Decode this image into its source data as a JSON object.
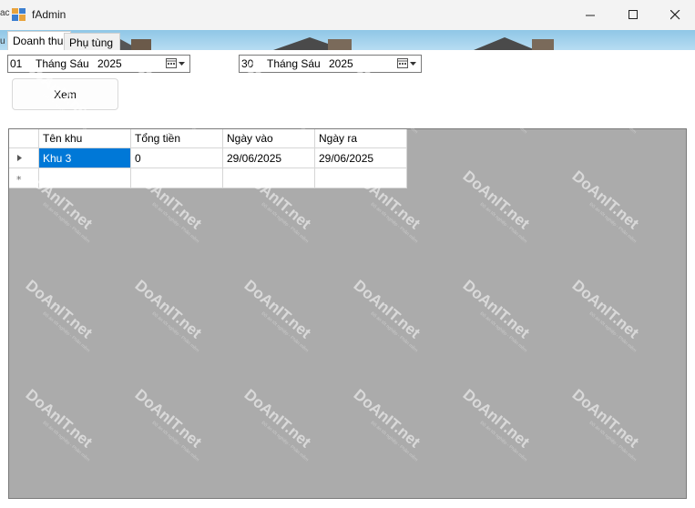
{
  "window": {
    "title": "fAdmin",
    "left_edge_text": "ac",
    "left_edge_text2": "u"
  },
  "tabs": [
    {
      "label": "Doanh thu",
      "active": true
    },
    {
      "label": "Phụ tùng",
      "active": false
    }
  ],
  "filters": {
    "from_date": {
      "day": "01",
      "month": "Tháng Sáu",
      "year": "2025"
    },
    "to_date": {
      "day": "30",
      "month": "Tháng Sáu",
      "year": "2025"
    },
    "view_button": "Xem"
  },
  "grid": {
    "columns": [
      "Tên khu",
      "Tổng tiền",
      "Ngày vào",
      "Ngày ra"
    ],
    "rows": [
      [
        "Khu 3",
        "0",
        "29/06/2025",
        "29/06/2025"
      ]
    ]
  },
  "watermark": {
    "text": "DoAnIT.net",
    "subtext": "Đồ án tốt nghiệp - Phần mềm"
  },
  "colors": {
    "selection": "#0078d7",
    "grid_background": "#ababab",
    "banner": "#9fd0ec"
  }
}
